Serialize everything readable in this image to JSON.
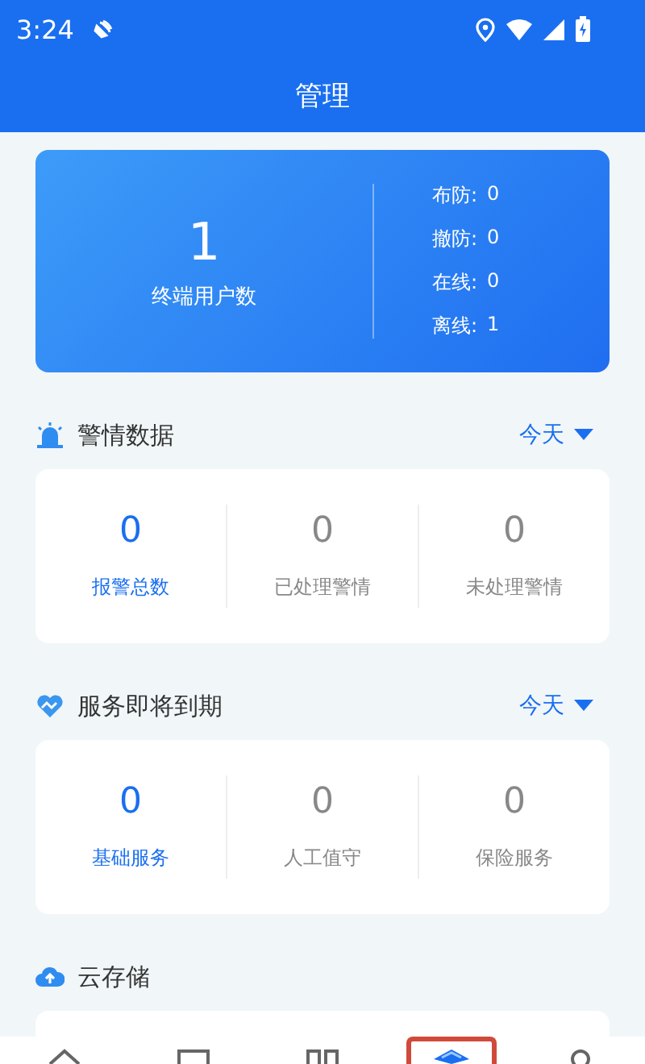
{
  "status_bar": {
    "time": "3:24"
  },
  "header": {
    "title": "管理"
  },
  "summary": {
    "count": "1",
    "label": "终端用户数",
    "stats": [
      {
        "label": "布防:",
        "value": "0"
      },
      {
        "label": "撤防:",
        "value": "0"
      },
      {
        "label": "在线:",
        "value": "0"
      },
      {
        "label": "离线:",
        "value": "1"
      }
    ]
  },
  "sections": [
    {
      "kind": "alarm",
      "title": "警情数据",
      "filter": "今天",
      "metrics": [
        {
          "value": "0",
          "label": "报警总数",
          "selected": true
        },
        {
          "value": "0",
          "label": "已处理警情",
          "selected": false
        },
        {
          "value": "0",
          "label": "未处理警情",
          "selected": false
        }
      ]
    },
    {
      "kind": "service",
      "title": "服务即将到期",
      "filter": "今天",
      "metrics": [
        {
          "value": "0",
          "label": "基础服务",
          "selected": true
        },
        {
          "value": "0",
          "label": "人工值守",
          "selected": false
        },
        {
          "value": "0",
          "label": "保险服务",
          "selected": false
        }
      ]
    },
    {
      "kind": "cloud",
      "title": "云存储"
    }
  ],
  "bottom_nav": [
    {
      "kind": "home",
      "selected": false
    },
    {
      "kind": "device",
      "selected": false
    },
    {
      "kind": "grid",
      "selected": false
    },
    {
      "kind": "manage",
      "selected": true
    },
    {
      "kind": "user",
      "selected": false
    }
  ]
}
